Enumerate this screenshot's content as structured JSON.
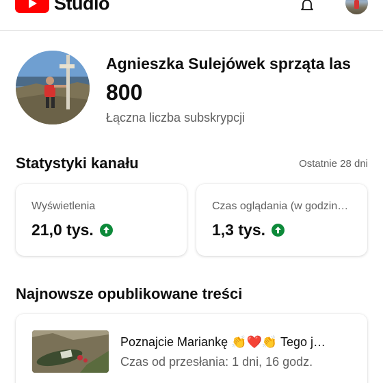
{
  "app": {
    "logo_text": "Studio",
    "brand_color": "#ff0000"
  },
  "channel": {
    "name": "Agnieszka Sulejówek sprząta las",
    "subscribers": "800",
    "subscribers_label": "Łączna liczba subskrypcji"
  },
  "stats": {
    "title": "Statystyki kanału",
    "period": "Ostatnie 28 dni",
    "cards": [
      {
        "label": "Wyświetlenia",
        "value": "21,0 tys.",
        "trend": "up"
      },
      {
        "label": "Czas oglądania (w godzinach)",
        "value": "1,3 tys.",
        "trend": "up"
      }
    ],
    "trend_color": "#0d8a3a"
  },
  "latest": {
    "title": "Najnowsze opublikowane treści",
    "items": [
      {
        "title": "Poznajcie Mariankę 👏❤️👏 Tego j…",
        "meta": "Czas od przesłania: 1 dni, 16 godz."
      }
    ]
  }
}
